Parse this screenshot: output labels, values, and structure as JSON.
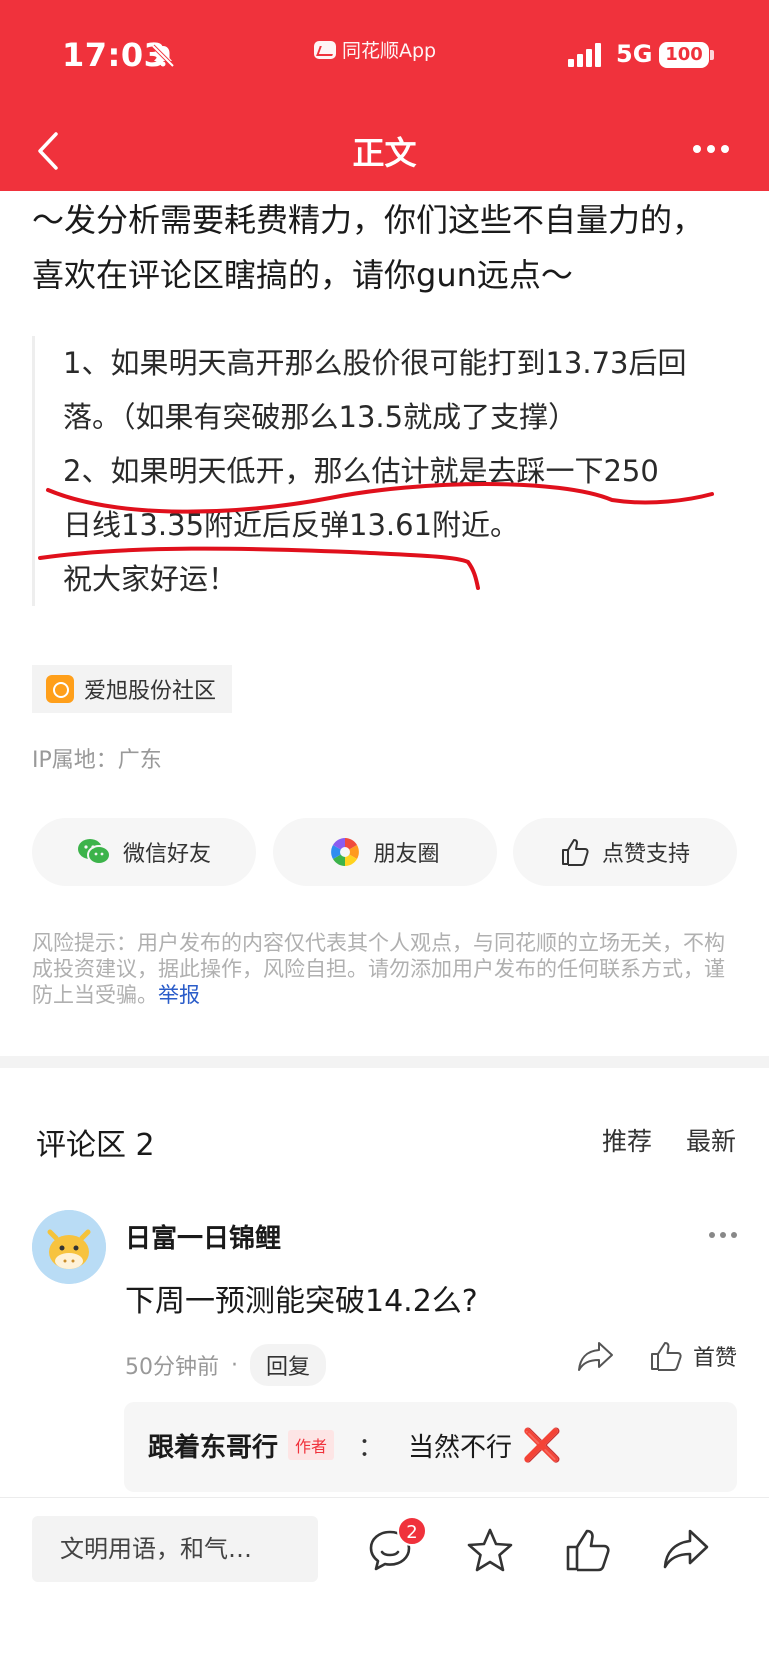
{
  "status_bar": {
    "time": "17:03",
    "app_name": "同花顺App",
    "network": "5G",
    "battery": "100"
  },
  "nav": {
    "title": "正文"
  },
  "article": {
    "line1": "～发分析需要耗费精力，你们这些不自量力的，",
    "line2": "喜欢在评论区瞎搞的，请你gun远点～",
    "quote_lines": [
      "1、如果明天高开那么股价很可能打到13.73后回",
      "落。（如果有突破那么13.5就成了支撑）",
      "2、如果明天低开，那么估计就是去踩一下250",
      "日线13.35附近后反弹13.61附近。",
      "祝大家好运！"
    ]
  },
  "community_tag": "爱旭股份社区",
  "ip_location": "IP属地：广东",
  "share": {
    "wechat": "微信好友",
    "moments": "朋友圈",
    "like": "点赞支持"
  },
  "risk_notice": {
    "text": "风险提示：用户发布的内容仅代表其个人观点，与同花顺的立场无关，不构成投资建议，据此操作，风险自担。请勿添加用户发布的任何联系方式，谨防上当受骗。",
    "report_link": "举报"
  },
  "comments": {
    "title": "评论区 2",
    "sort_recommended": "推荐",
    "sort_latest": "最新",
    "items": [
      {
        "author": "日富一日锦鲤",
        "text": "下周一预测能突破14.2么?",
        "time": "50分钟前",
        "reply_label": "回复",
        "like_label": "首赞",
        "reply": {
          "author": "跟着东哥行",
          "badge": "作者",
          "colon": "：",
          "text": "当然不行",
          "emoji": "❌"
        }
      }
    ]
  },
  "bottom_bar": {
    "input_placeholder": "文明用语，和气…",
    "comment_count": "2"
  },
  "colors": {
    "brand_red": "#f0323c",
    "link_blue": "#2a5cc9",
    "annotation_red": "#e0101c"
  }
}
